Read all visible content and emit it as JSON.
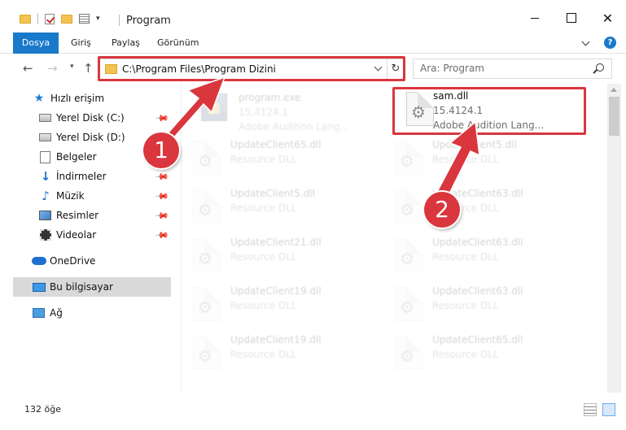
{
  "window": {
    "title": "Program"
  },
  "ribbon": {
    "tabs": [
      "Dosya",
      "Giriş",
      "Paylaş",
      "Görünüm"
    ]
  },
  "address": {
    "path": "C:\\Program Files\\Program Dizini"
  },
  "search": {
    "placeholder": "Ara: Program"
  },
  "sidebar": {
    "items": [
      {
        "label": "Hızlı erişim",
        "icon": "star-icon"
      },
      {
        "label": "Yerel Disk (C:)",
        "icon": "drive-icon",
        "pinned": true
      },
      {
        "label": "Yerel Disk (D:)",
        "icon": "drive-icon"
      },
      {
        "label": "Belgeler",
        "icon": "documents-icon"
      },
      {
        "label": "İndirmeler",
        "icon": "downloads-icon",
        "pinned": true
      },
      {
        "label": "Müzik",
        "icon": "music-icon",
        "pinned": true
      },
      {
        "label": "Resimler",
        "icon": "pictures-icon",
        "pinned": true
      },
      {
        "label": "Videolar",
        "icon": "videos-icon",
        "pinned": true
      },
      {
        "label": "OneDrive",
        "icon": "cloud-icon"
      },
      {
        "label": "Bu bilgisayar",
        "icon": "computer-icon",
        "selected": true
      },
      {
        "label": "Ağ",
        "icon": "network-icon"
      }
    ]
  },
  "files": {
    "highlighted": {
      "name": "sam.dll",
      "version": "15.4124.1",
      "description": "Adobe Audition Lang..."
    },
    "program_exe": {
      "name": "program.exe",
      "version": "15.4124.1",
      "description": "Adobe Audition Lang..."
    },
    "faded_left": [
      {
        "name": "UpdateClient65.dll",
        "type": "Resource DLL"
      },
      {
        "name": "UpdateClient5.dll",
        "type": "Resource DLL"
      },
      {
        "name": "UpdateClient21.dll",
        "type": "Resource DLL"
      },
      {
        "name": "UpdateClient19.dll",
        "type": "Resource DLL"
      },
      {
        "name": "UpdateClient19.dll",
        "type": "Resource DLL"
      }
    ],
    "faded_right": [
      {
        "name": "UpdateClient5.dll",
        "type": "Resource DLL"
      },
      {
        "name": "UpdateClient63.dll",
        "type": "Resource DLL"
      },
      {
        "name": "UpdateClient63.dll",
        "type": "Resource DLL"
      },
      {
        "name": "UpdateClient63.dll",
        "type": "Resource DLL"
      },
      {
        "name": "UpdateClient65.dll",
        "type": "Resource DLL"
      }
    ]
  },
  "status": {
    "item_count": "132 öğe"
  },
  "callouts": [
    "1",
    "2"
  ],
  "colors": {
    "accent": "#1979ca",
    "highlight_red": "#d9363e",
    "selected_nav": "#d9d9d9"
  }
}
